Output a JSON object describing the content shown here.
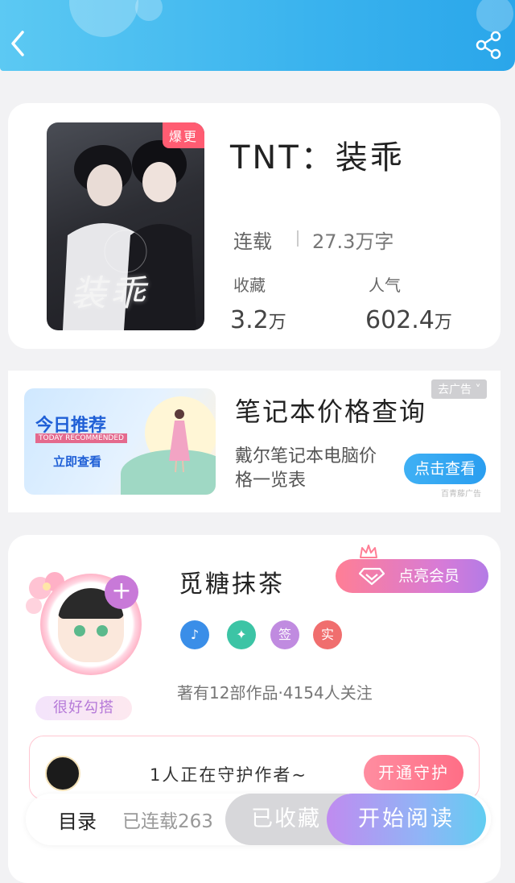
{
  "header": {
    "back_icon": "chevron-left-icon",
    "share_icon": "share-icon"
  },
  "book": {
    "cover_badge": "爆更",
    "cover_title": "装乖",
    "title": "TNT：装乖",
    "status": "连载",
    "word_count": "27.3万字",
    "collect_label": "收藏",
    "collect_value": "3.2",
    "collect_unit": "万",
    "popularity_label": "人气",
    "popularity_value": "602.4",
    "popularity_unit": "万"
  },
  "ad": {
    "tag": "去广告",
    "banner_today": "今日推荐",
    "banner_en": "TODAY RECOMMENDED",
    "banner_check": "立即查看",
    "title": "笔记本价格查询",
    "description": "戴尔笔记本电脑价格一览表",
    "button": "点击查看",
    "source": "百青藤广告"
  },
  "author": {
    "name": "觅糖抹茶",
    "avatar_tag": "很好勾搭",
    "plus": "+",
    "vip_button": "点亮会员",
    "badges": [
      {
        "text": "♪",
        "color": "#3a8ee8"
      },
      {
        "text": "✦",
        "color": "#3cc4a5"
      },
      {
        "text": "签",
        "color": "#c08be0"
      },
      {
        "text": "实",
        "color": "#f06e6e"
      }
    ],
    "stats": "著有12部作品·4154人关注"
  },
  "guard": {
    "text": "1人正在守护作者~",
    "button": "开通守护"
  },
  "bottom": {
    "toc": "目录",
    "toc_info": "已连载263",
    "collected": "已收藏",
    "read": "开始阅读"
  },
  "colors": {
    "header_blue": "#3ab3ee",
    "accent_pink": "#ff6e86",
    "accent_purple": "#c08bf0"
  }
}
